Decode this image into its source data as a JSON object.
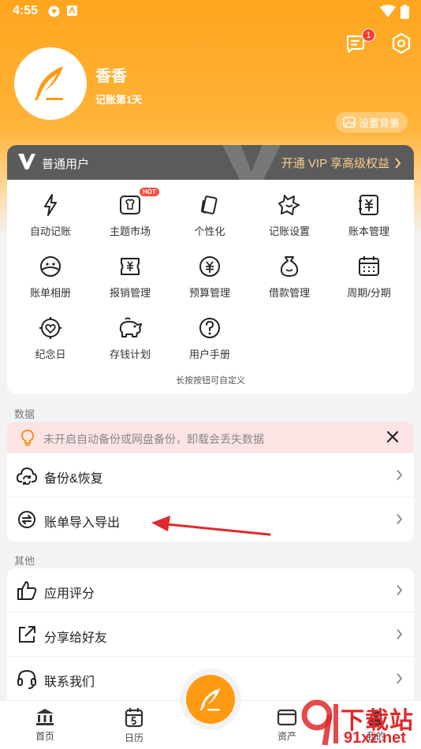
{
  "status_bar": {
    "time": "4:55"
  },
  "header": {
    "username": "香香",
    "days": "记账第1天",
    "bg_button": "设置背景",
    "message_badge": "1"
  },
  "vip": {
    "tier": "普通用户",
    "cta": "开通 VIP 享高级权益"
  },
  "grid": {
    "items": [
      {
        "label": "自动记账",
        "icon": "lightning-icon"
      },
      {
        "label": "主题市场",
        "icon": "tshirt-icon",
        "tag": "HOT"
      },
      {
        "label": "个性化",
        "icon": "cards-icon"
      },
      {
        "label": "记账设置",
        "icon": "star-settings-icon"
      },
      {
        "label": "账本管理",
        "icon": "ledger-yen-icon"
      },
      {
        "label": "账单相册",
        "icon": "album-face-icon"
      },
      {
        "label": "报销管理",
        "icon": "receipt-yen-icon"
      },
      {
        "label": "预算管理",
        "icon": "budget-yen-icon"
      },
      {
        "label": "借款管理",
        "icon": "money-bag-icon"
      },
      {
        "label": "周期/分期",
        "icon": "calendar-icon"
      },
      {
        "label": "纪念日",
        "icon": "heart-target-icon"
      },
      {
        "label": "存钱计划",
        "icon": "piggy-bank-icon"
      },
      {
        "label": "用户手册",
        "icon": "help-icon"
      }
    ],
    "hint": "长按按钮可自定义"
  },
  "sections": {
    "data_label": "数据",
    "other_label": "其他"
  },
  "alert": {
    "text": "未开启自动备份或网盘备份，卸载会丢失数据"
  },
  "data_rows": [
    {
      "label": "备份&恢复",
      "icon": "cloud-sync-icon"
    },
    {
      "label": "账单导入导出",
      "icon": "import-export-icon"
    }
  ],
  "other_rows": [
    {
      "label": "应用评分",
      "icon": "thumbs-up-icon"
    },
    {
      "label": "分享给好友",
      "icon": "share-icon"
    },
    {
      "label": "联系我们",
      "icon": "headset-icon"
    }
  ],
  "bottom_nav": [
    {
      "label": "首页",
      "icon": "bank-icon"
    },
    {
      "label": "日历",
      "icon": "calendar-5-icon"
    },
    {
      "label": "资产",
      "icon": "wallet-icon"
    },
    {
      "label": "我的",
      "icon": "profile-icon"
    }
  ],
  "watermark": {
    "line1": "下载站",
    "line2": "91xz.net"
  },
  "colors": {
    "accent": "#ff9a12",
    "vip_bar": "#5b5b5b",
    "vip_gold": "#f6cf8a",
    "alert_bg": "#fde4e4",
    "annotation": "#e0292c"
  }
}
